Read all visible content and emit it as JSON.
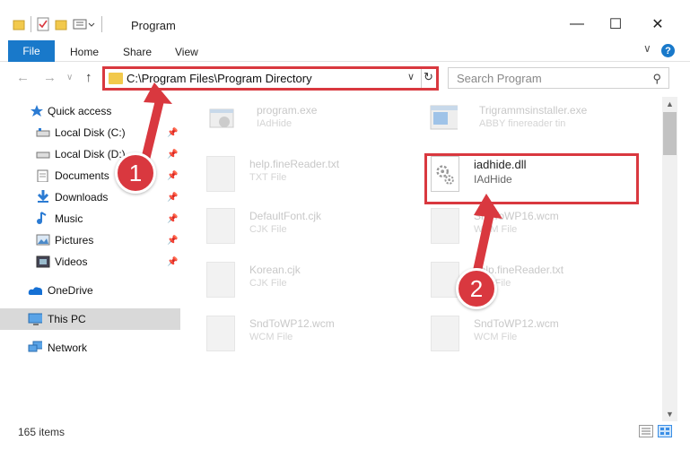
{
  "window": {
    "title": "Program",
    "minimize_glyph": "—",
    "maximize_glyph": "☐",
    "close_glyph": "✕"
  },
  "ribbon": {
    "file_label": "File",
    "tabs": [
      "Home",
      "Share",
      "View"
    ],
    "help_glyph": "?",
    "expand_glyph": "∨"
  },
  "nav": {
    "back_glyph": "←",
    "forward_glyph": "→",
    "recent_glyph": "∨",
    "up_glyph": "↑",
    "address": "C:\\Program Files\\Program Directory",
    "address_dropdown_glyph": "∨",
    "refresh_glyph": "↻",
    "search_placeholder": "Search Program",
    "search_glyph": "⚲"
  },
  "sidebar": {
    "items": [
      {
        "label": "Quick access",
        "icon": "star-icon"
      },
      {
        "label": "Local Disk (C:)",
        "icon": "drive-icon",
        "pinned": true
      },
      {
        "label": "Local Disk (D:)",
        "icon": "drive-icon",
        "pinned": true
      },
      {
        "label": "Documents",
        "icon": "documents-icon",
        "pinned": true
      },
      {
        "label": "Downloads",
        "icon": "downloads-icon",
        "pinned": true
      },
      {
        "label": "Music",
        "icon": "music-icon",
        "pinned": true
      },
      {
        "label": "Pictures",
        "icon": "pictures-icon",
        "pinned": true
      },
      {
        "label": "Videos",
        "icon": "videos-icon",
        "pinned": true
      },
      {
        "label": "OneDrive",
        "icon": "onedrive-icon"
      },
      {
        "label": "This PC",
        "icon": "computer-icon",
        "selected": true
      },
      {
        "label": "Network",
        "icon": "network-icon"
      }
    ],
    "pin_glyph": "📌"
  },
  "files": [
    {
      "name": "program.exe",
      "type": "IAdHide"
    },
    {
      "name": "Trigrammsinstaller.exe",
      "type": "ABBY finereader tin"
    },
    {
      "name": "help.fineReader.txt",
      "type": "TXT File"
    },
    {
      "name": "iadhide.dll",
      "type": "IAdHide",
      "highlighted": true
    },
    {
      "name": "DefaultFont.cjk",
      "type": "CJK File"
    },
    {
      "name": "SndToWP16.wcm",
      "type": "WCM File"
    },
    {
      "name": "Korean.cjk",
      "type": "CJK File"
    },
    {
      "name": "help.fineReader.txt",
      "type": "TXT File"
    },
    {
      "name": "SndToWP12.wcm",
      "type": "WCM File"
    },
    {
      "name": "SndToWP12.wcm",
      "type": "WCM File"
    }
  ],
  "status": {
    "item_count": "165 items"
  },
  "annotations": {
    "step1": "1",
    "step2": "2",
    "color": "#d9383f"
  },
  "colors": {
    "accent": "#1979ca",
    "folder": "#f2c94c",
    "highlight": "#d9383f"
  }
}
